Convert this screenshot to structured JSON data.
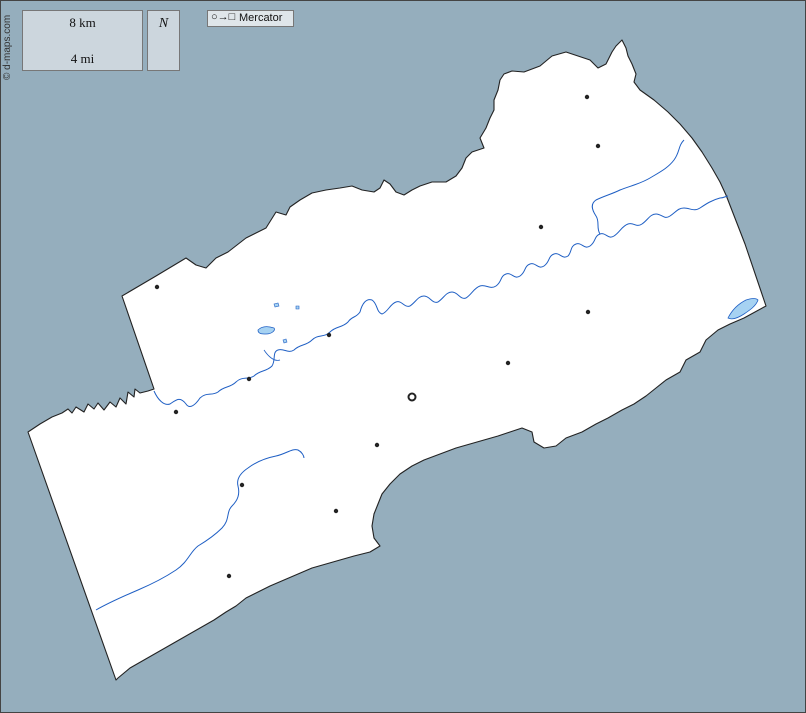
{
  "credit": "© d-maps.com",
  "scale": {
    "km_label": "8 km",
    "mi_label": "4 mi"
  },
  "north": {
    "label": "N"
  },
  "projection": {
    "symbol": "○→□",
    "label": "Mercator"
  },
  "colors": {
    "sea": "#95aebd",
    "land": "#ffffff",
    "water": "#1f5fc4",
    "lake": "#a6d2f2",
    "border": "#222222",
    "panel": "#ccd6dd"
  },
  "icons": [
    "compass-rose-icon",
    "city-dot-icon",
    "capital-ring-icon"
  ]
}
